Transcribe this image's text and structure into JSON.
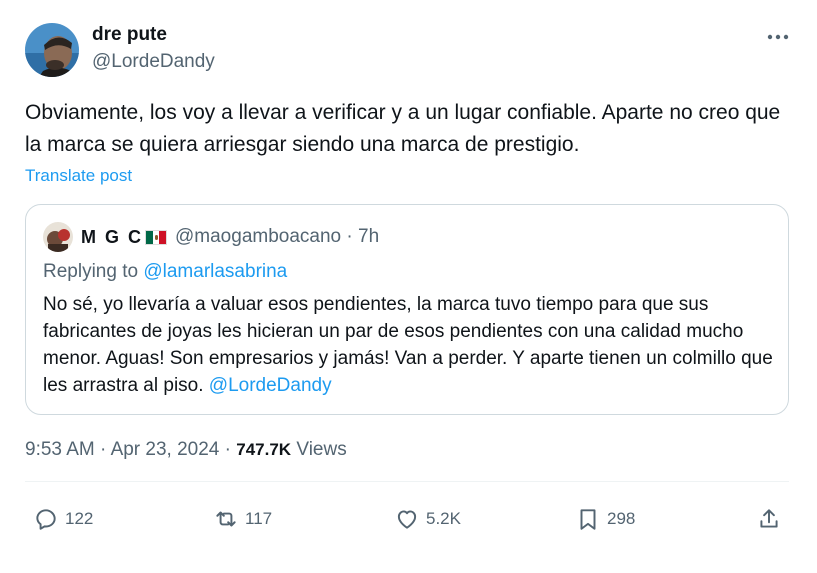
{
  "author": {
    "name": "dre pute",
    "handle": "@LordeDandy",
    "avatar_icon": "person-avatar-icon"
  },
  "tweet": {
    "text": "Obviamente, los voy a llevar a verificar y a un lugar confiable. Aparte no creo que la marca se quiera arriesgar siendo una marca de prestigio.",
    "translate_label": "Translate post"
  },
  "quote": {
    "name": "M G C",
    "flag_icon": "mexico-flag-icon",
    "handle": "@maogamboacano",
    "separator": " · ",
    "time": "7h",
    "reply_prefix": "Replying to ",
    "reply_to": "@lamarlasabrina",
    "text": "No sé, yo llevaría a valuar esos pendientes, la marca tuvo tiempo para que sus fabricantes de joyas les hicieran un par de esos pendientes con una calidad mucho menor. Aguas! Son empresarios y jamás! Van a perder. Y aparte tienen un colmillo que les arrastra al piso. ",
    "mention": "@LordeDandy"
  },
  "meta": {
    "time": "9:53 AM",
    "separator": " · ",
    "date": "Apr 23, 2024",
    "views_count": "747.7K",
    "views_label": " Views"
  },
  "actions": {
    "replies": "122",
    "reposts": "117",
    "likes": "5.2K",
    "bookmarks": "298"
  },
  "colors": {
    "accent": "#1d9bf0",
    "secondary_text": "#536471",
    "primary_text": "#0f1419",
    "border": "#cfd9de"
  }
}
